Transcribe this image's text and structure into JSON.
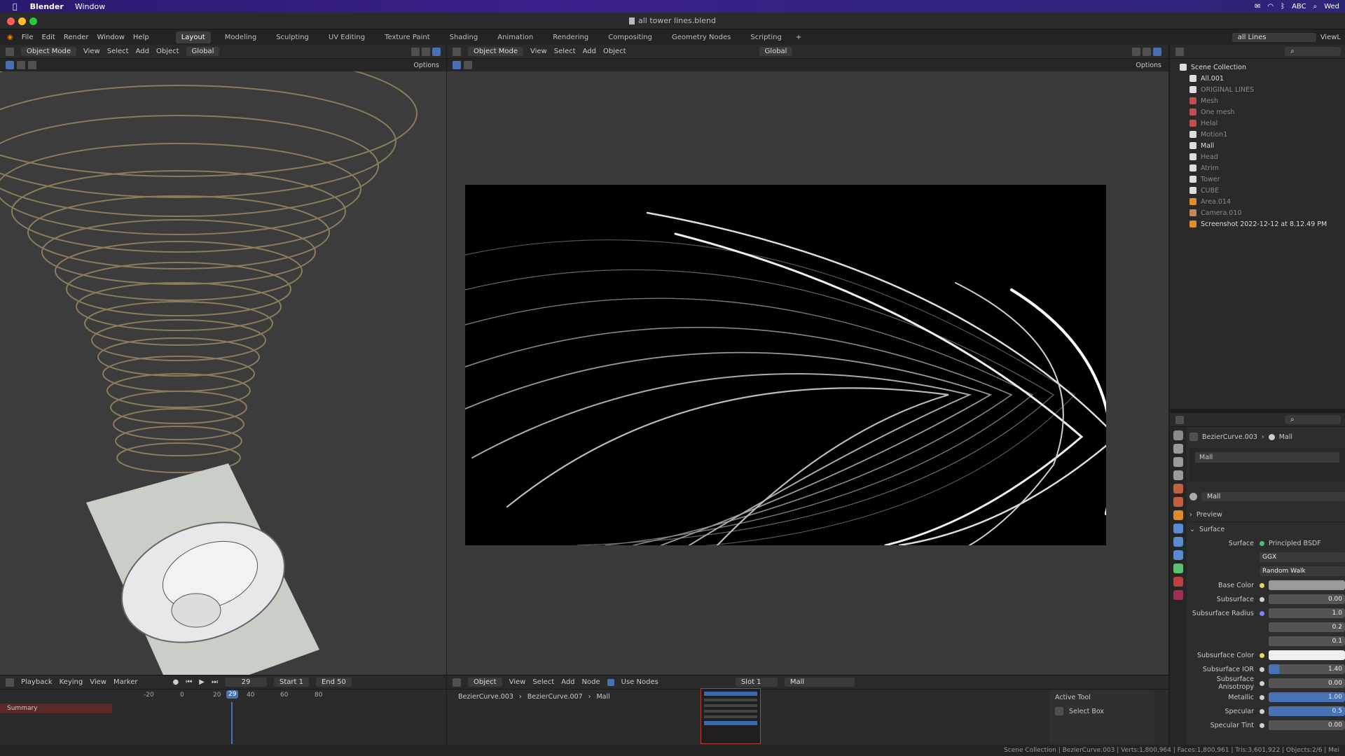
{
  "macos": {
    "app_name": "Blender",
    "menu_window": "Window",
    "right_items": [
      "ABC",
      "Wed"
    ]
  },
  "window": {
    "title": "all tower lines.blend"
  },
  "menu": {
    "items": [
      "File",
      "Edit",
      "Render",
      "Window",
      "Help"
    ]
  },
  "workspaces": [
    "Layout",
    "Modeling",
    "Sculpting",
    "UV Editing",
    "Texture Paint",
    "Shading",
    "Animation",
    "Rendering",
    "Compositing",
    "Geometry Nodes",
    "Scripting"
  ],
  "viewport_left": {
    "mode": "Object Mode",
    "menus": [
      "View",
      "Select",
      "Add",
      "Object"
    ],
    "orientation": "Global",
    "options": "Options"
  },
  "viewport_right": {
    "mode": "Object Mode",
    "menus": [
      "View",
      "Select",
      "Add",
      "Object"
    ],
    "orientation": "Global",
    "options": "Options"
  },
  "scene_selector": "all Lines",
  "view_layer": "ViewL",
  "outliner": {
    "items": [
      {
        "label": "Scene Collection",
        "dim": false,
        "color": "#dddddd"
      },
      {
        "label": "All.001",
        "dim": false,
        "color": "#dddddd"
      },
      {
        "label": "ORIGINAL LINES",
        "dim": true,
        "color": "#dddddd"
      },
      {
        "label": "Mesh",
        "dim": true,
        "color": "#c05050"
      },
      {
        "label": "One mesh",
        "dim": true,
        "color": "#c05050"
      },
      {
        "label": "Helal",
        "dim": true,
        "color": "#c05050"
      },
      {
        "label": "Motion1",
        "dim": true,
        "color": "#dddddd"
      },
      {
        "label": "Mall",
        "dim": false,
        "color": "#dddddd"
      },
      {
        "label": "Head",
        "dim": true,
        "color": "#dddddd"
      },
      {
        "label": "Atrim",
        "dim": true,
        "color": "#dddddd"
      },
      {
        "label": "Tower",
        "dim": true,
        "color": "#dddddd"
      },
      {
        "label": "CUBE",
        "dim": true,
        "color": "#dddddd"
      },
      {
        "label": "Area.014",
        "dim": true,
        "color": "#e0902a"
      },
      {
        "label": "Camera.010",
        "dim": true,
        "color": "#c08a60"
      },
      {
        "label": "Screenshot 2022-12-12 at 8.12.49 PM",
        "dim": false,
        "color": "#e0902a"
      }
    ]
  },
  "properties": {
    "breadcrumb": [
      "BezierCurve.003",
      "Mall"
    ],
    "slot_material": "Mall",
    "material_name": "Mall",
    "panel_preview": "Preview",
    "panel_surface": "Surface",
    "surface_label": "Surface",
    "surface_value": "Principled BSDF",
    "distribution": "GGX",
    "subsurface_method": "Random Walk",
    "rows": [
      {
        "label": "Base Color",
        "value": "",
        "dot": "#e8d84a",
        "type": "color"
      },
      {
        "label": "Subsurface",
        "value": "0.00",
        "dot": "#cfcfcf",
        "type": "num"
      },
      {
        "label": "Subsurface Radius",
        "value": "1.0",
        "dot": "#7f7fff",
        "type": "num"
      },
      {
        "label": "",
        "value": "0.2",
        "dot": "",
        "type": "num"
      },
      {
        "label": "",
        "value": "0.1",
        "dot": "",
        "type": "num"
      },
      {
        "label": "Subsurface Color",
        "value": "",
        "dot": "#e8d84a",
        "type": "white"
      },
      {
        "label": "Subsurface IOR",
        "value": "1.40",
        "dot": "#cfcfcf",
        "type": "partial"
      },
      {
        "label": "Subsurface Anisotropy",
        "value": "0.00",
        "dot": "#cfcfcf",
        "type": "num"
      },
      {
        "label": "Metallic",
        "value": "1.00",
        "dot": "#cfcfcf",
        "type": "blue"
      },
      {
        "label": "Specular",
        "value": "0.5",
        "dot": "#cfcfcf",
        "type": "blue"
      },
      {
        "label": "Specular Tint",
        "value": "0.00",
        "dot": "#cfcfcf",
        "type": "num"
      }
    ]
  },
  "timeline": {
    "menus": [
      "Playback",
      "Keying",
      "View",
      "Marker"
    ],
    "current_frame": "29",
    "start_label": "Start",
    "start": "1",
    "end_label": "End",
    "end": "50",
    "ticks": [
      "-20",
      "0",
      "20",
      "29",
      "40",
      "60",
      "80"
    ],
    "summary": "Summary"
  },
  "node_editor": {
    "type": "Object",
    "menus": [
      "View",
      "Select",
      "Add",
      "Node"
    ],
    "use_nodes": "Use Nodes",
    "slot": "Slot 1",
    "material": "Mall",
    "breadcrumb": [
      "BezierCurve.003",
      "BezierCurve.007",
      "Mall"
    ],
    "active_tool_title": "Active Tool",
    "active_tool_name": "Select Box"
  },
  "status_bar": {
    "text": "Scene Collection | BezierCurve.003 | Verts:1,800,964 | Faces:1,800,961 | Tris:3,601,922 | Objects:2/6 | Mei"
  }
}
